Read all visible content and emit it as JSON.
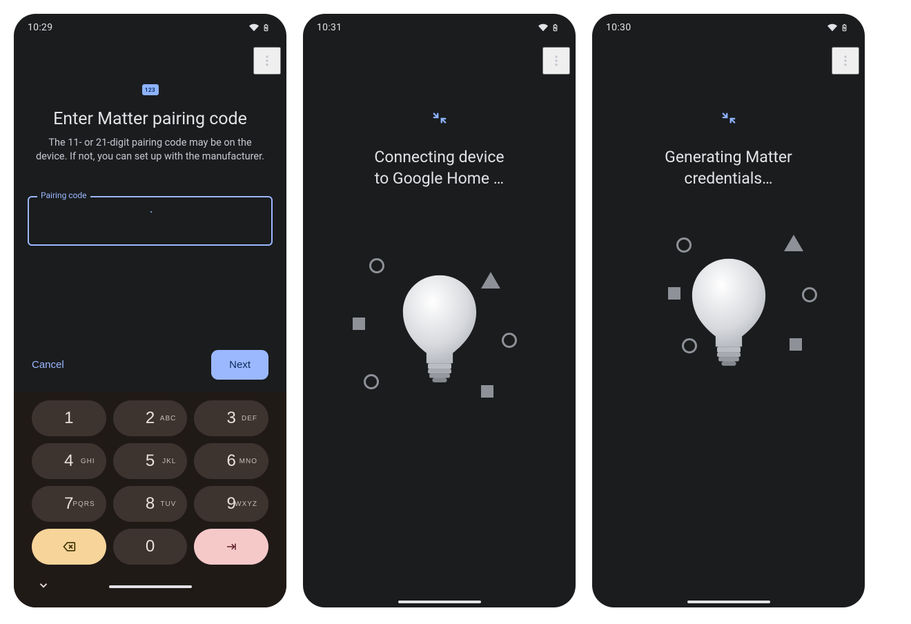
{
  "colors": {
    "bg": "#1a1c1e",
    "text": "#e3e2e6",
    "textMuted": "#c5c6d0",
    "accent": "#9bb8ff",
    "keypadBg": "#201a17",
    "keyBg": "#3d332f",
    "keyBackBg": "#f6d49a",
    "keyEnterBg": "#f6c9c9",
    "shape": "#8e9198"
  },
  "screens": [
    {
      "status": {
        "time": "10:29"
      },
      "badge": "123",
      "title": "Enter Matter pairing code",
      "subtitle": "The 11- or 21-digit pairing code may be on the device. If not, you can set up with the manufacturer.",
      "field_label": "Pairing code",
      "field_value": "",
      "cancel": "Cancel",
      "next": "Next",
      "keypad": {
        "rows": [
          [
            {
              "n": "1",
              "l": ""
            },
            {
              "n": "2",
              "l": "ABC"
            },
            {
              "n": "3",
              "l": "DEF"
            }
          ],
          [
            {
              "n": "4",
              "l": "GHI"
            },
            {
              "n": "5",
              "l": "JKL"
            },
            {
              "n": "6",
              "l": "MNO"
            }
          ],
          [
            {
              "n": "7",
              "l": "PQRS"
            },
            {
              "n": "8",
              "l": "TUV"
            },
            {
              "n": "9",
              "l": "WXYZ"
            }
          ],
          [
            {
              "n": "back",
              "l": ""
            },
            {
              "n": "0",
              "l": ""
            },
            {
              "n": "enter",
              "l": ""
            }
          ]
        ]
      }
    },
    {
      "status": {
        "time": "10:31"
      },
      "title": "Connecting device\nto Google Home …"
    },
    {
      "status": {
        "time": "10:30"
      },
      "title": "Generating Matter credentials…"
    }
  ]
}
